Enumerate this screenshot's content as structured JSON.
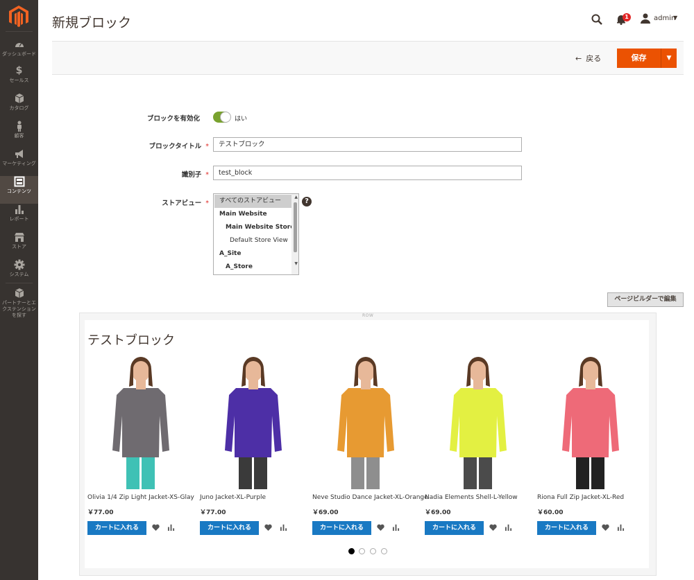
{
  "sidebar": {
    "items": [
      {
        "label": "ダッシュボード",
        "icon": "dashboard-icon"
      },
      {
        "label": "セールス",
        "icon": "dollar-icon"
      },
      {
        "label": "カタログ",
        "icon": "box-icon"
      },
      {
        "label": "顧客",
        "icon": "person-icon"
      },
      {
        "label": "マーケティング",
        "icon": "megaphone-icon"
      },
      {
        "label": "コンテンツ",
        "icon": "layout-icon"
      },
      {
        "label": "レポート",
        "icon": "bar-chart-icon"
      },
      {
        "label": "ストア",
        "icon": "store-icon"
      },
      {
        "label": "システム",
        "icon": "gear-icon"
      },
      {
        "label": "パートナーとエクステンションを探す",
        "icon": "cube-icon"
      }
    ]
  },
  "header": {
    "title": "新規ブロック",
    "notifications_count": "1",
    "user": "admin"
  },
  "actions": {
    "back_label": "戻る",
    "save_label": "保存"
  },
  "form": {
    "enable_label": "ブロックを有効化",
    "enable_value": "はい",
    "title_label": "ブロックタイトル",
    "title_value": "テストブロック",
    "identifier_label": "識別子",
    "identifier_value": "test_block",
    "store_view_label": "ストアビュー",
    "store_options": [
      "すべてのストアビュー",
      "Main Website",
      "Main Website Store",
      "Default Store View",
      "A_Site",
      "A_Store"
    ],
    "help": "?"
  },
  "page_builder": {
    "edit_button": "ページビルダーで編集",
    "row_label": "ROW",
    "block_title": "テストブロック",
    "products": [
      {
        "name": "Olivia 1/4 Zip Light Jacket-XS-Glay",
        "price": "￥77.00",
        "color": "#6f6b70",
        "legs": "#3fc1b5",
        "cart": "カートに入れる"
      },
      {
        "name": "Juno Jacket-XL-Purple",
        "price": "￥77.00",
        "color": "#4d2fa6",
        "legs": "#3a3a3a",
        "cart": "カートに入れる"
      },
      {
        "name": "Neve Studio Dance Jacket-XL-Orange",
        "price": "￥69.00",
        "color": "#e79a32",
        "legs": "#8e8e8e",
        "cart": "カートに入れる"
      },
      {
        "name": "Nadia Elements Shell-L-Yellow",
        "price": "￥69.00",
        "color": "#e3f042",
        "legs": "#4b4b4b",
        "cart": "カートに入れる"
      },
      {
        "name": "Riona Full Zip Jacket-XL-Red",
        "price": "￥60.00",
        "color": "#ee6a78",
        "legs": "#222222",
        "cart": "カートに入れる"
      }
    ]
  },
  "colors": {
    "accent": "#eb5202",
    "cart_button": "#1979c3",
    "toggle_on": "#79a22e"
  }
}
